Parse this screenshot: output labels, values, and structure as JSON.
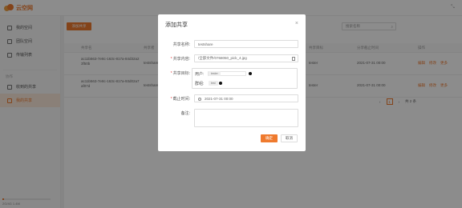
{
  "app": {
    "logo_text": "云空网",
    "top_right_icon": "collapse-icon"
  },
  "sidebar": {
    "items": [
      {
        "label": "我的空间",
        "icon": "drive-icon"
      },
      {
        "label": "团队空间",
        "icon": "team-icon"
      },
      {
        "label": "传输列表",
        "icon": "transfer-icon"
      }
    ],
    "group_title": "协作",
    "group_items": [
      {
        "label": "收到的共享",
        "icon": "inbox-icon"
      },
      {
        "label": "我的共享",
        "icon": "share-icon",
        "active": true
      }
    ],
    "storage_text": "2G/4G 1.4M",
    "storage_fraction": 0.03
  },
  "main": {
    "add_button": "添加共享",
    "search_placeholder": "搜索名称",
    "headers": [
      "共享名",
      "共享者",
      "共享目标",
      "分享截止时间",
      "操作"
    ],
    "rows": [
      {
        "name": "ac11b563-7e8c-163c-817a-84d32a23f50b",
        "owner": "testshare",
        "target": "tester",
        "time": "2021-07-31 00:00",
        "actions": [
          "编辑",
          "修改",
          "更多"
        ]
      },
      {
        "name": "ac11b563-7e8c-163c-817a-93d02a7af07d",
        "owner": "testshare",
        "target": "tester",
        "time": "2021-07-31 00:00",
        "actions": [
          "编辑",
          "修改",
          "更多"
        ]
      }
    ],
    "pager": {
      "prev": "‹",
      "current": "1",
      "next": "›",
      "total": "共 2 条"
    }
  },
  "modal": {
    "title": "添加共享",
    "close": "×",
    "name_label": "共享名称:",
    "name_value": "testshare",
    "file_label": "共享内容:",
    "file_value": "/全部文件/0768050_pick_4.jpg",
    "target_label": "共享目标:",
    "user_label": "用户:",
    "user_tag": "tester",
    "group_label": "群组:",
    "group_tag": "test",
    "deadline_label": "截止时间:",
    "deadline_value": "2021-07-31 00:00",
    "remark_label": "备注:",
    "ok": "确定",
    "cancel": "取消"
  },
  "colors": {
    "accent": "#ef7a2e",
    "overlay": "rgba(0,0,0,0.45)"
  }
}
